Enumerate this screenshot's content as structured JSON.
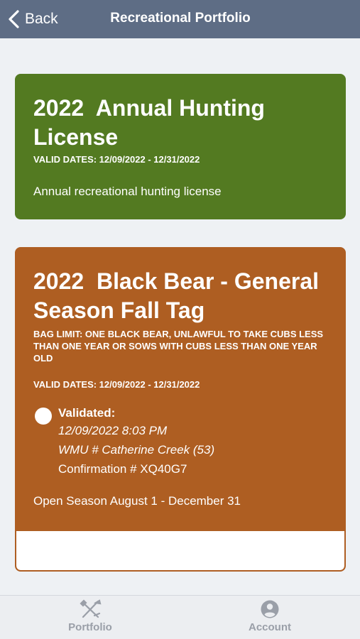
{
  "header": {
    "back_label": "Back",
    "title": "Recreational Portfolio",
    "bar_color": "#5e6d85"
  },
  "license_card": {
    "title": "2022  Annual Hunting License",
    "valid_dates": "VALID DATES: 12/09/2022 - 12/31/2022",
    "description": "Annual recreational hunting license",
    "color": "#537a21"
  },
  "tag_card": {
    "title": "2022  Black Bear - General Season Fall Tag",
    "bag_limit": "BAG LIMIT:  ONE BLACK BEAR, UNLAWFUL TO TAKE CUBS LESS THAN ONE YEAR OR SOWS WITH CUBS LESS THAN ONE YEAR OLD",
    "valid_dates": "VALID DATES: 12/09/2022 - 12/31/2022",
    "validated_label": "Validated:",
    "validated_datetime": "12/09/2022 8:03 PM",
    "wmu": "WMU # Catherine Creek (53)",
    "confirmation": "Confirmation # XQ40G7",
    "season": "Open Season August 1 - December 31",
    "color": "#ae5e22"
  },
  "tabbar": {
    "tabs": [
      {
        "label": "Portfolio",
        "icon": "crossed-tools-icon"
      },
      {
        "label": "Account",
        "icon": "account-circle-icon"
      }
    ]
  }
}
